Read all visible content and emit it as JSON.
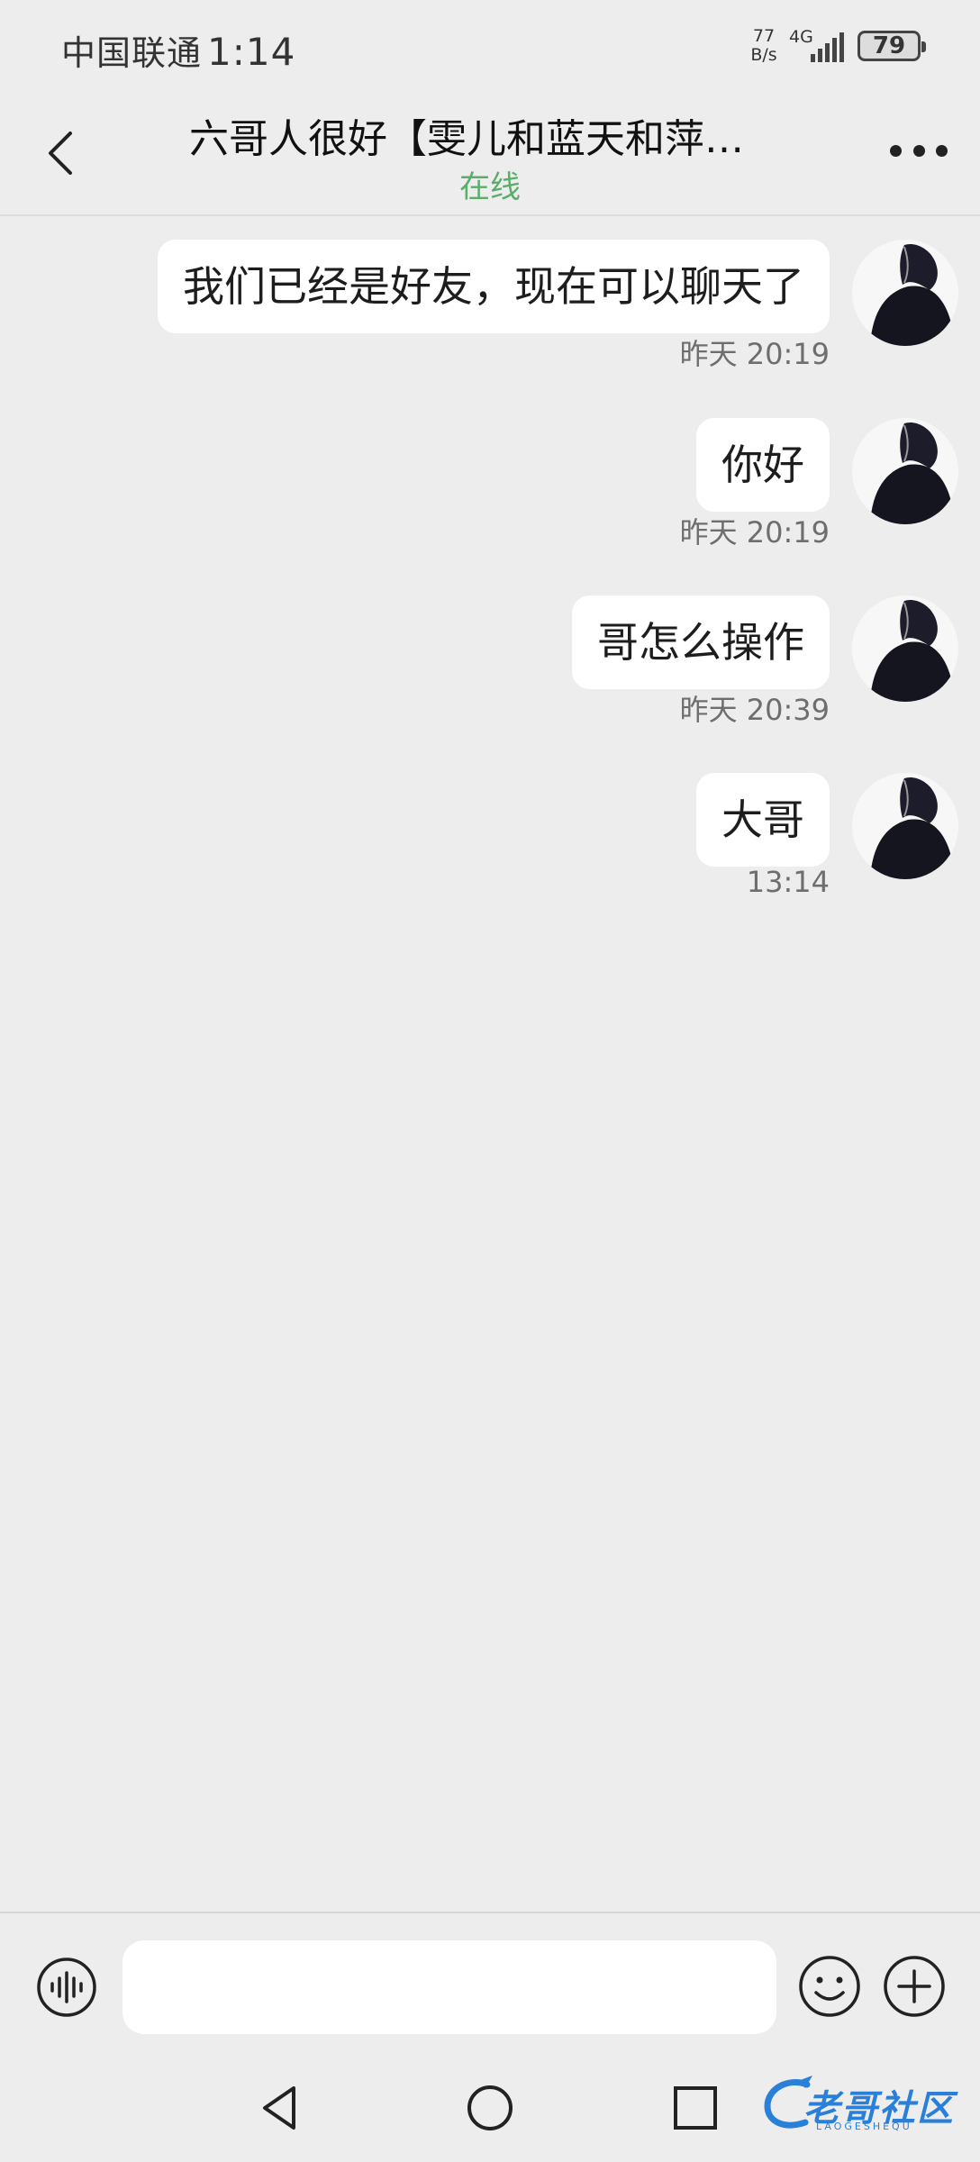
{
  "status_bar": {
    "carrier": "中国联通",
    "time": "1:14",
    "net_speed_value": "77",
    "net_speed_unit": "B/s",
    "network_type": "4G",
    "battery": "79"
  },
  "header": {
    "title": "六哥人很好【雯儿和蓝天和萍…",
    "status": "在线"
  },
  "messages": [
    {
      "text": "我们已经是好友，现在可以聊天了",
      "time": "昨天 20:19"
    },
    {
      "text": "你好",
      "time": "昨天 20:19"
    },
    {
      "text": "哥怎么操作",
      "time": "昨天 20:39"
    },
    {
      "text": "大哥",
      "time": "13:14"
    }
  ],
  "input": {
    "placeholder": ""
  },
  "watermark": {
    "text": "老哥社区",
    "sub": "LAOGESHEQU"
  },
  "colors": {
    "background": "#ededed",
    "bubble": "#ffffff",
    "online": "#5bad6b"
  },
  "icons": {
    "back": "chevron-left-icon",
    "more": "ellipsis-icon",
    "voice": "voice-wave-icon",
    "emoji": "smiley-icon",
    "plus": "plus-circle-icon"
  }
}
